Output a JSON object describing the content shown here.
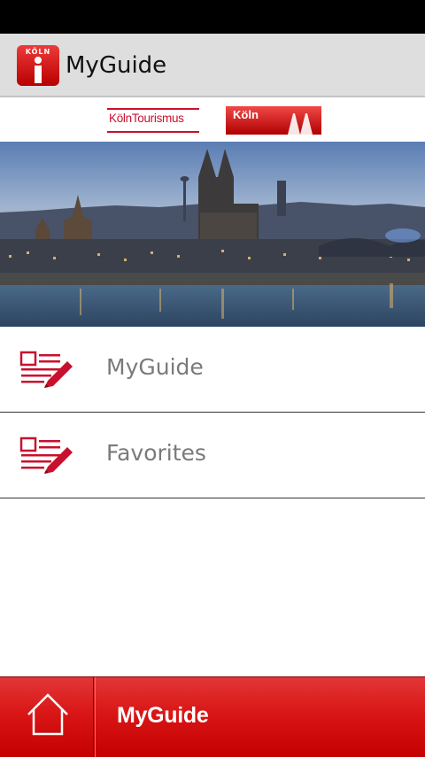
{
  "action_bar": {
    "title": "MyGuide",
    "app_icon": "koln-info-icon",
    "app_icon_label": "KÖLN"
  },
  "logos": {
    "tourismus": "KölnTourismus",
    "koln": "Köln"
  },
  "hero": {
    "image": "cologne-skyline-photo"
  },
  "menu": {
    "items": [
      {
        "label": "MyGuide",
        "icon": "notes-pencil-icon"
      },
      {
        "label": "Favorites",
        "icon": "notes-pencil-icon"
      }
    ]
  },
  "bottom_bar": {
    "title": "MyGuide",
    "home_icon": "home-icon"
  },
  "colors": {
    "brand_red": "#c8102e",
    "bar_red": "#d91616",
    "action_bar_bg": "#dedede",
    "label_gray": "#7a7a7a"
  }
}
